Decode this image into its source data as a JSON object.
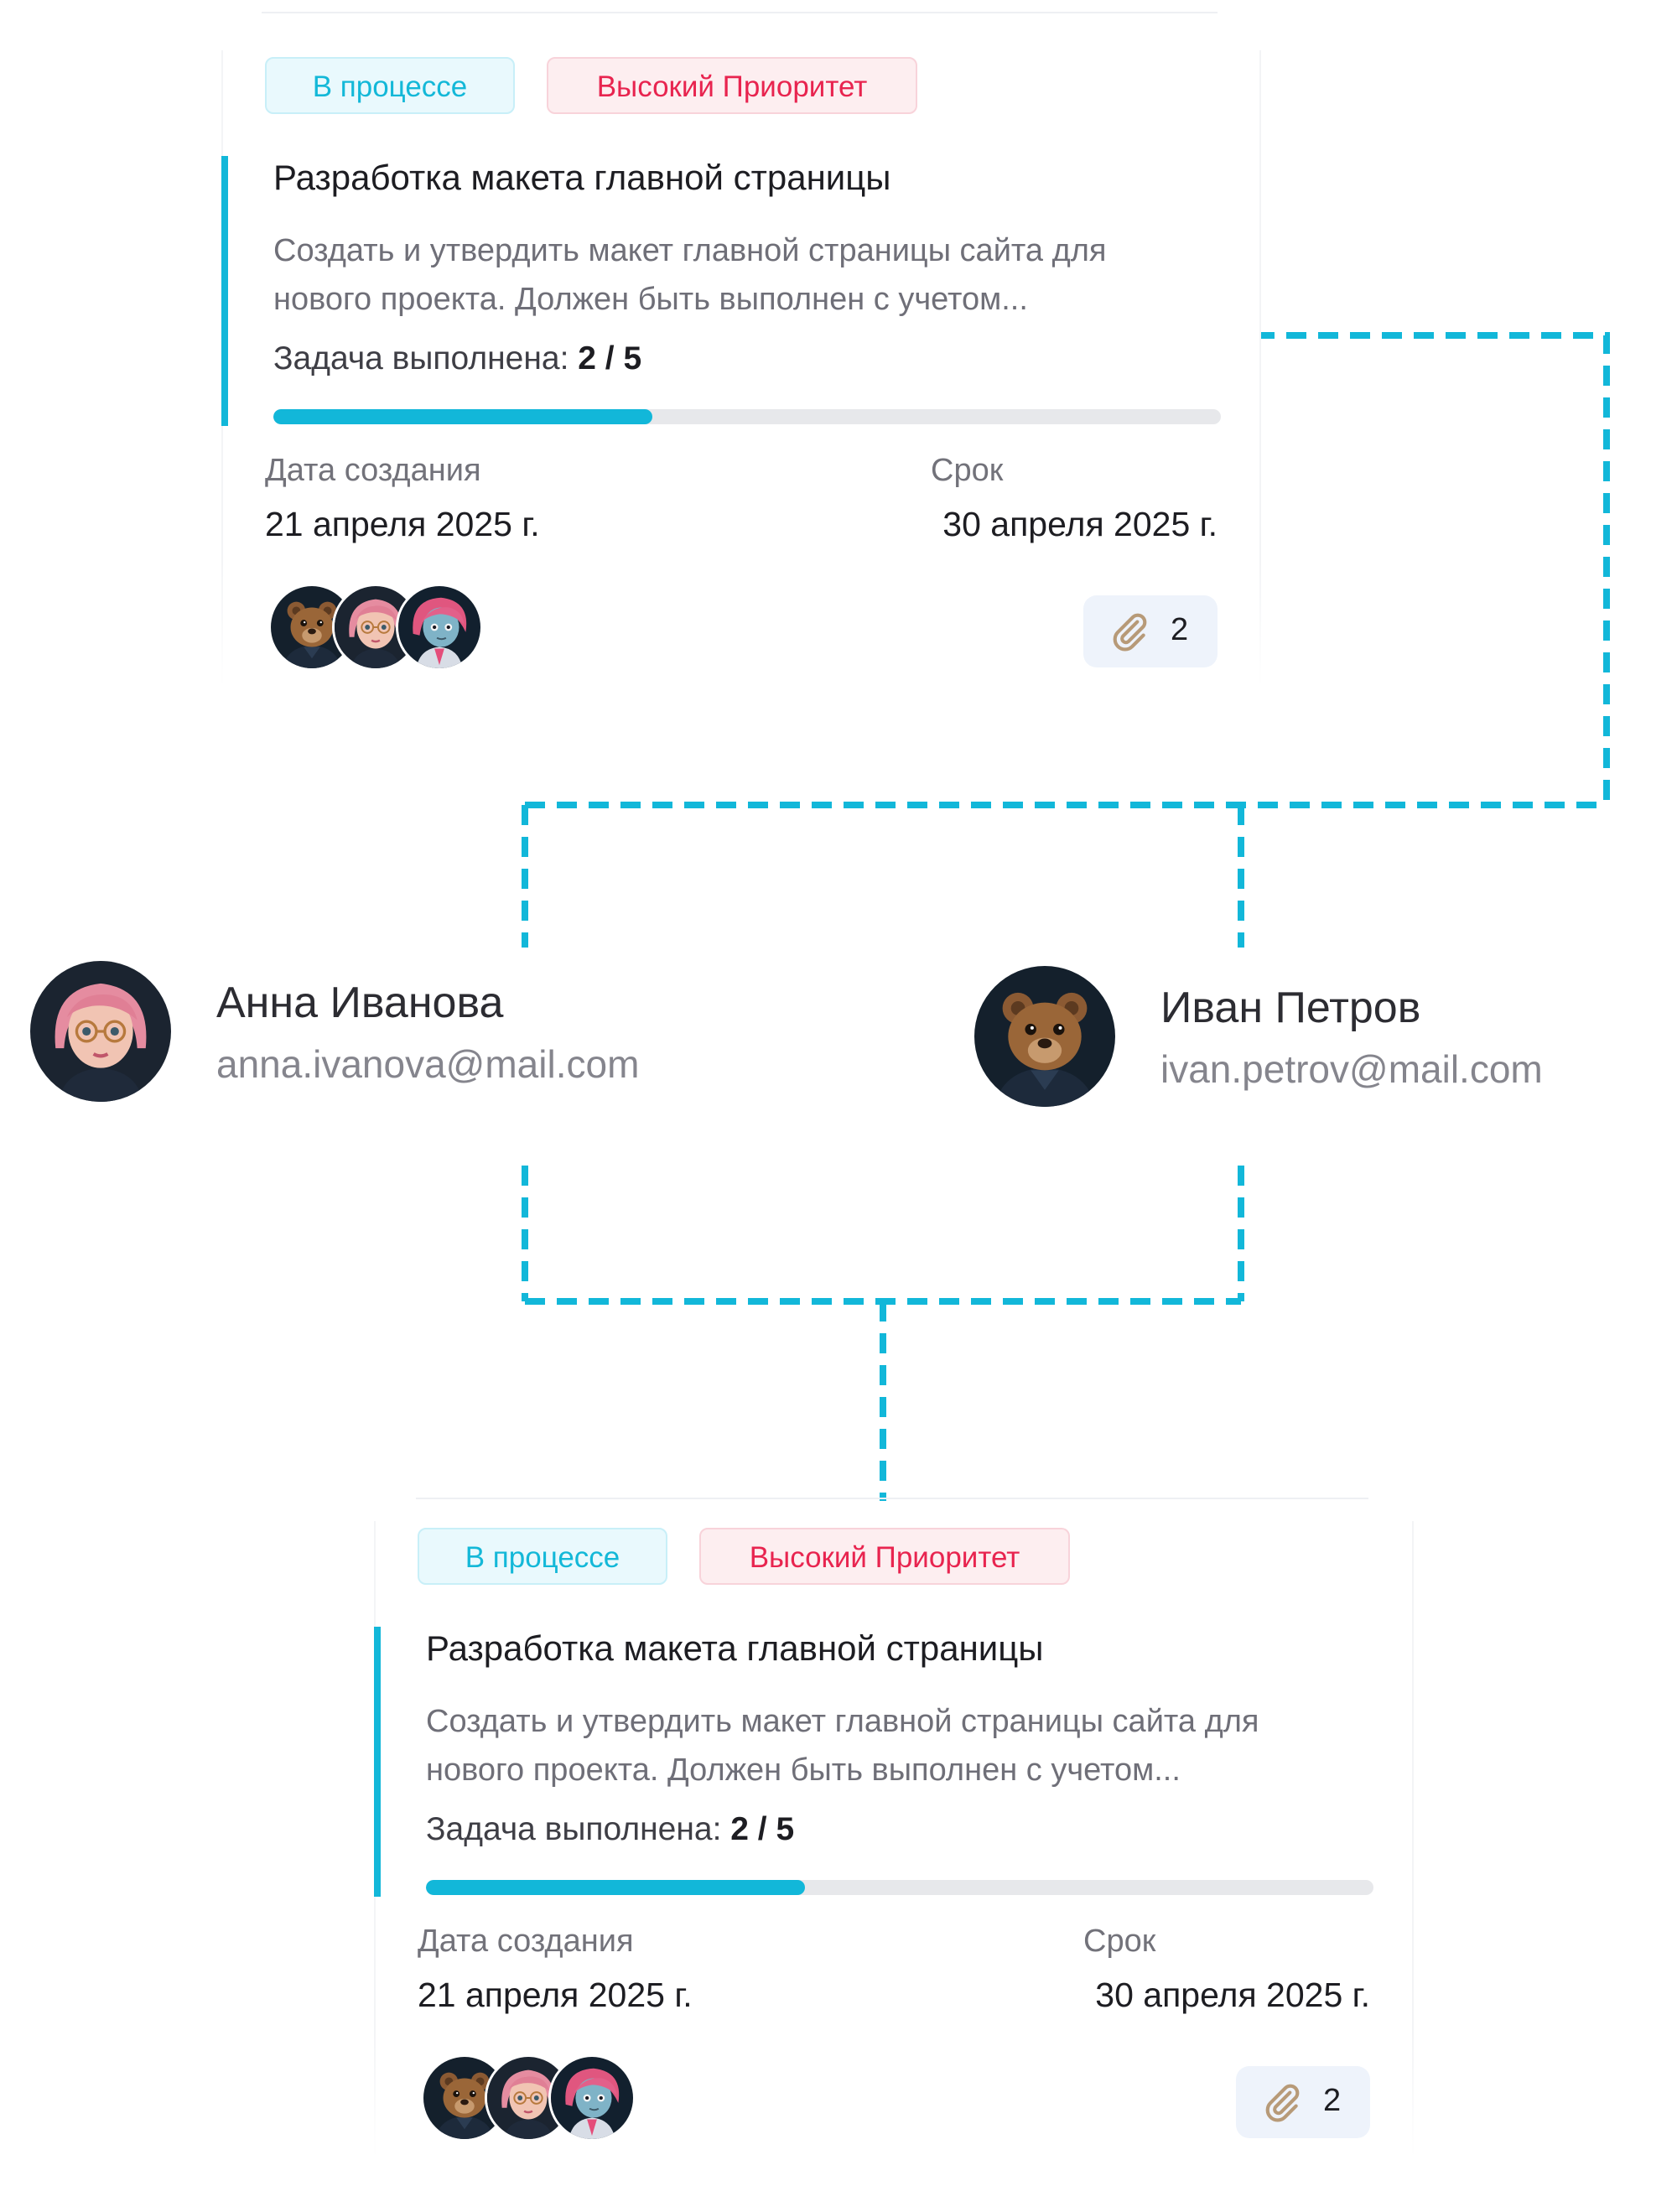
{
  "colors": {
    "accent": "#12b7d9",
    "status": "#13b8d8",
    "priority": "#e8244f"
  },
  "cards": [
    {
      "status": "В процессе",
      "priority": "Высокий Приоритет",
      "title": "Разработка макета главной страницы",
      "description_line1": "Создать и утвердить макет главной страницы сайта для",
      "description_line2": "нового проекта. Должен быть выполнен с учетом...",
      "progress_label": "Задача выполнена:",
      "progress_value": "2 / 5",
      "progress_fraction": 0.4,
      "created_label": "Дата создания",
      "created_value": "21 апреля 2025 г.",
      "due_label": "Срок",
      "due_value": "30 апреля 2025 г.",
      "attachments": "2",
      "avatars": [
        "bear-avatar",
        "glasses-girl-avatar",
        "pink-hair-avatar"
      ]
    },
    {
      "status": "В процессе",
      "priority": "Высокий Приоритет",
      "title": "Разработка макета главной страницы",
      "description_line1": "Создать и утвердить макет главной страницы сайта для",
      "description_line2": "нового проекта. Должен быть выполнен с учетом...",
      "progress_label": "Задача выполнена:",
      "progress_value": "2 / 5",
      "progress_fraction": 0.4,
      "created_label": "Дата создания",
      "created_value": "21 апреля 2025 г.",
      "due_label": "Срок",
      "due_value": "30 апреля 2025 г.",
      "attachments": "2",
      "avatars": [
        "bear-avatar",
        "glasses-girl-avatar",
        "pink-hair-avatar"
      ]
    }
  ],
  "people": [
    {
      "name": "Анна Иванова",
      "email": "anna.ivanova@mail.com",
      "avatar": "glasses-girl-avatar"
    },
    {
      "name": "Иван Петров",
      "email": "ivan.petrov@mail.com",
      "avatar": "bear-avatar"
    }
  ]
}
